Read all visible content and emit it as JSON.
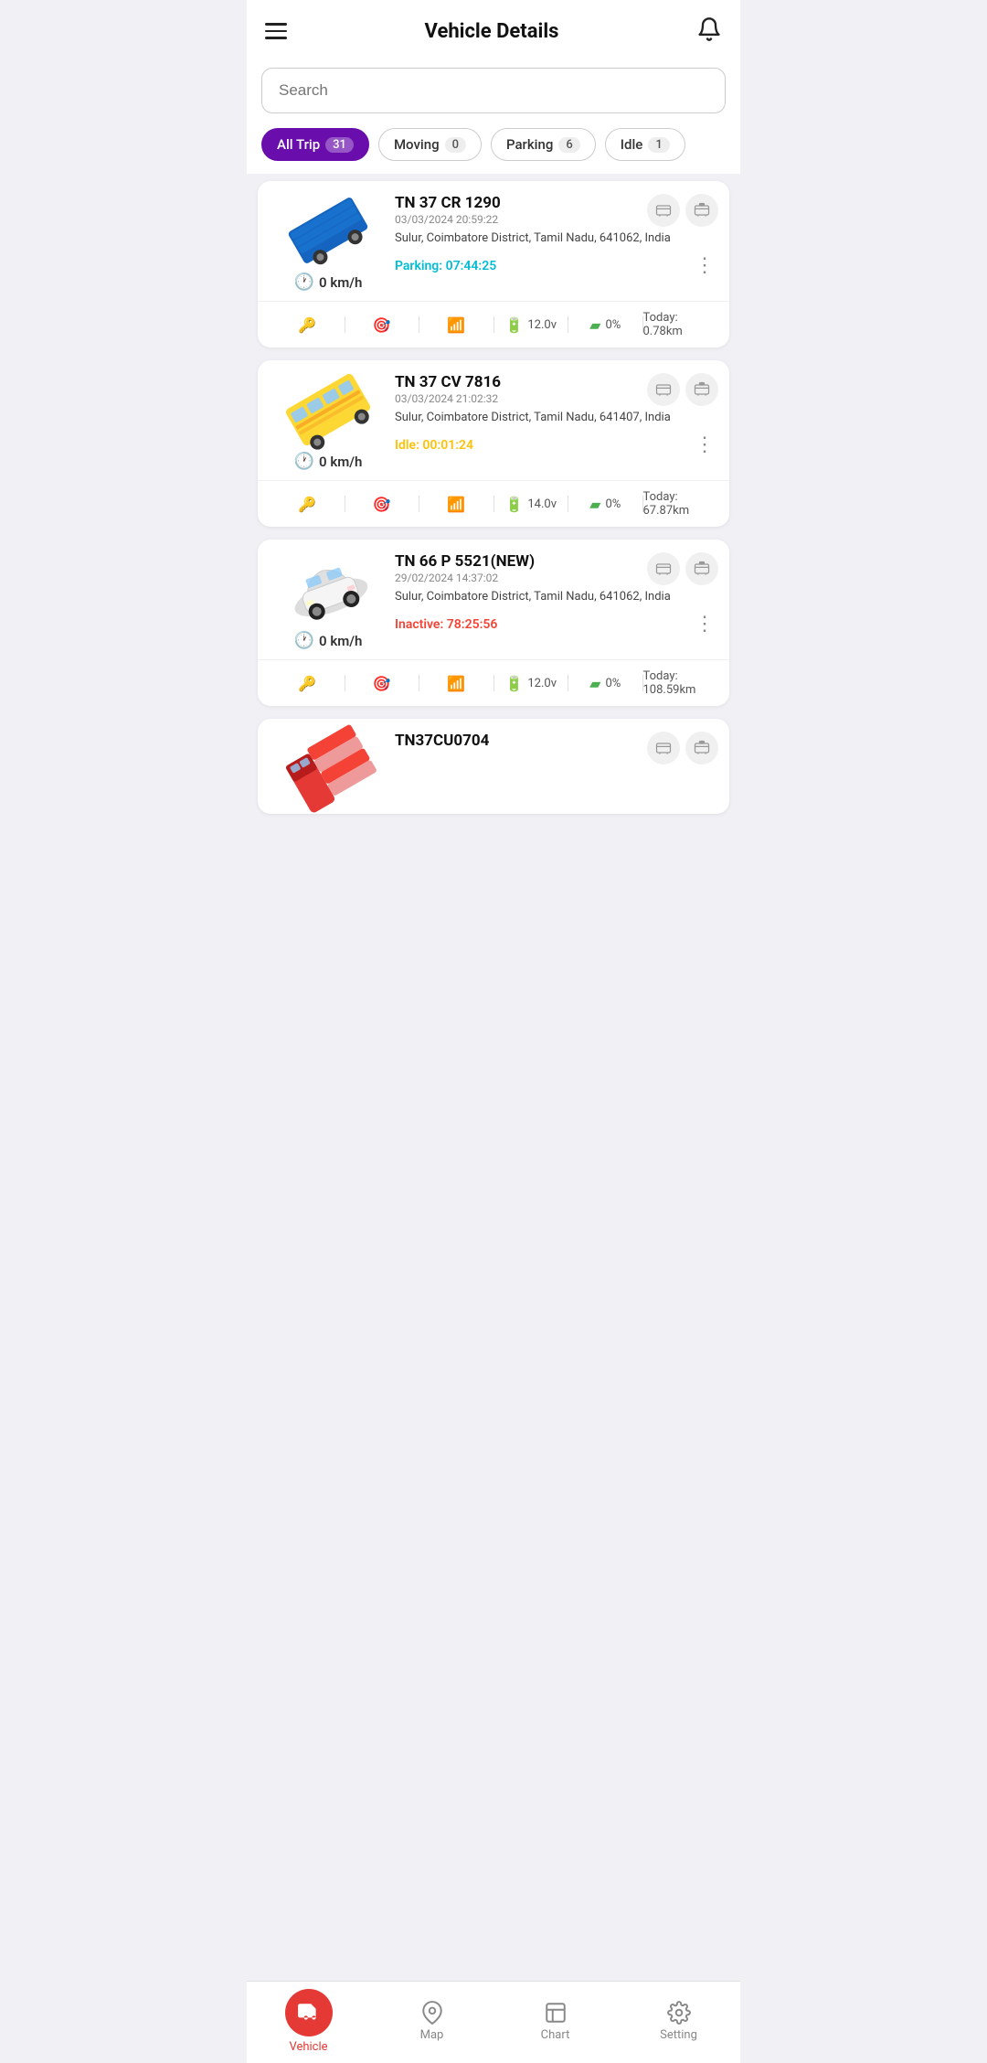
{
  "header": {
    "title": "Vehicle Details",
    "notification_icon": "bell-icon"
  },
  "search": {
    "placeholder": "Search"
  },
  "filters": [
    {
      "label": "All Trip",
      "count": "31",
      "active": true
    },
    {
      "label": "Moving",
      "count": "0",
      "active": false
    },
    {
      "label": "Parking",
      "count": "6",
      "active": false
    },
    {
      "label": "Idle",
      "count": "1",
      "active": false
    }
  ],
  "vehicles": [
    {
      "id": "TN 37 CR 1290",
      "date": "03/03/2024 20:59:22",
      "location": "Sulur, Coimbatore District, Tamil Nadu, 641062, India",
      "status_type": "parking",
      "status_label": "Parking:",
      "status_time": "07:44:25",
      "speed": "0 km/h",
      "voltage": "12.0v",
      "battery": "0%",
      "today_km": "Today: 0.78km",
      "vehicle_type": "blue-truck"
    },
    {
      "id": "TN 37 CV 7816",
      "date": "03/03/2024 21:02:32",
      "location": "Sulur, Coimbatore District, Tamil Nadu, 641407, India",
      "status_type": "idle",
      "status_label": "Idle:",
      "status_time": "00:01:24",
      "speed": "0 km/h",
      "voltage": "14.0v",
      "battery": "0%",
      "today_km": "Today: 67.87km",
      "vehicle_type": "yellow-bus"
    },
    {
      "id": "TN 66 P 5521(NEW)",
      "date": "29/02/2024 14:37:02",
      "location": "Sulur, Coimbatore District, Tamil Nadu, 641062, India",
      "status_type": "inactive",
      "status_label": "Inactive:",
      "status_time": "78:25:56",
      "speed": "0 km/h",
      "voltage": "12.0v",
      "battery": "0%",
      "today_km": "Today: 108.59km",
      "vehicle_type": "white-car"
    },
    {
      "id": "TN37CU0704",
      "date": "",
      "location": "",
      "status_type": "",
      "status_label": "",
      "status_time": "",
      "speed": "",
      "voltage": "",
      "battery": "",
      "today_km": "",
      "vehicle_type": "red-truck"
    }
  ],
  "bottom_nav": [
    {
      "label": "Vehicle",
      "icon": "vehicle-icon",
      "active": true
    },
    {
      "label": "Map",
      "icon": "map-icon",
      "active": false
    },
    {
      "label": "Chart",
      "icon": "chart-icon",
      "active": false
    },
    {
      "label": "Setting",
      "icon": "setting-icon",
      "active": false
    }
  ]
}
